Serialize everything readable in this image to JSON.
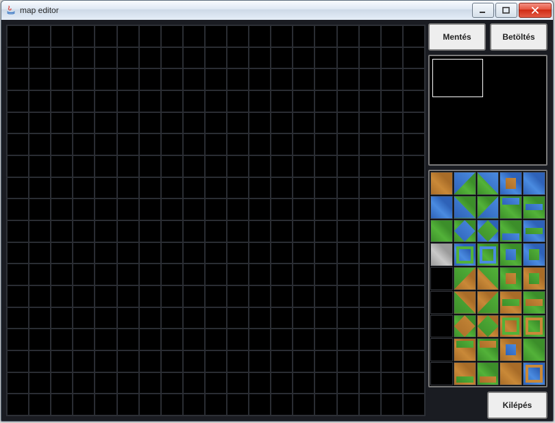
{
  "window": {
    "title": "map editor"
  },
  "buttons": {
    "save": "Mentés",
    "load": "Betöltés",
    "quit": "Kilépés"
  },
  "map_grid": {
    "cols": 19,
    "rows": 18
  },
  "palette": {
    "cols": 5,
    "rows": 9,
    "tiles": [
      {
        "base": "dirt"
      },
      {
        "base": "grass",
        "ov": "tri-tl",
        "oc": "water"
      },
      {
        "base": "grass",
        "ov": "tri-tr",
        "oc": "water"
      },
      {
        "base": "water",
        "ov": "center",
        "oc": "dirt"
      },
      {
        "base": "water"
      },
      {
        "base": "water"
      },
      {
        "base": "grass",
        "ov": "tri-bl",
        "oc": "water"
      },
      {
        "base": "grass",
        "ov": "tri-br",
        "oc": "water"
      },
      {
        "base": "grass",
        "ov": "hbar-top",
        "oc": "water"
      },
      {
        "base": "grass",
        "ov": "hbar",
        "oc": "water"
      },
      {
        "base": "grass"
      },
      {
        "base": "grass",
        "ov": "diamond",
        "oc": "water"
      },
      {
        "base": "water",
        "ov": "diamond",
        "oc": "grass"
      },
      {
        "base": "grass",
        "ov": "hbar-bot",
        "oc": "water"
      },
      {
        "base": "water",
        "ov": "hbar",
        "oc": "grass"
      },
      {
        "base": "stone"
      },
      {
        "base": "water",
        "ov": "frame",
        "fc": "frame-grass"
      },
      {
        "base": "grass",
        "ov": "frame",
        "fc": "frame-water"
      },
      {
        "base": "grass",
        "ov": "center",
        "oc": "water"
      },
      {
        "base": "water",
        "ov": "center",
        "oc": "grass"
      },
      {
        "base": "empty"
      },
      {
        "base": "dirt",
        "ov": "tri-tl",
        "oc": "grass"
      },
      {
        "base": "dirt",
        "ov": "tri-tr",
        "oc": "grass"
      },
      {
        "base": "grass",
        "ov": "center",
        "oc": "dirt"
      },
      {
        "base": "dirt",
        "ov": "center",
        "oc": "grass"
      },
      {
        "base": "empty"
      },
      {
        "base": "dirt",
        "ov": "tri-bl",
        "oc": "grass"
      },
      {
        "base": "dirt",
        "ov": "tri-br",
        "oc": "grass"
      },
      {
        "base": "dirt",
        "ov": "hbar",
        "oc": "grass"
      },
      {
        "base": "grass",
        "ov": "hbar",
        "oc": "dirt"
      },
      {
        "base": "empty"
      },
      {
        "base": "grass",
        "ov": "diamond",
        "oc": "dirt"
      },
      {
        "base": "dirt",
        "ov": "diamond",
        "oc": "grass"
      },
      {
        "base": "dirt",
        "ov": "frame",
        "fc": "frame-grass"
      },
      {
        "base": "grass",
        "ov": "frame",
        "fc": "frame-dirt"
      },
      {
        "base": "empty"
      },
      {
        "base": "dirt",
        "ov": "hbar-top",
        "oc": "grass"
      },
      {
        "base": "grass",
        "ov": "hbar-top",
        "oc": "dirt"
      },
      {
        "base": "dirt",
        "ov": "center",
        "oc": "water"
      },
      {
        "base": "grass"
      },
      {
        "base": "empty"
      },
      {
        "base": "dirt",
        "ov": "hbar-bot",
        "oc": "grass"
      },
      {
        "base": "grass",
        "ov": "hbar-bot",
        "oc": "dirt"
      },
      {
        "base": "dirt"
      },
      {
        "base": "water",
        "ov": "frame",
        "fc": "frame-dirt"
      }
    ]
  }
}
